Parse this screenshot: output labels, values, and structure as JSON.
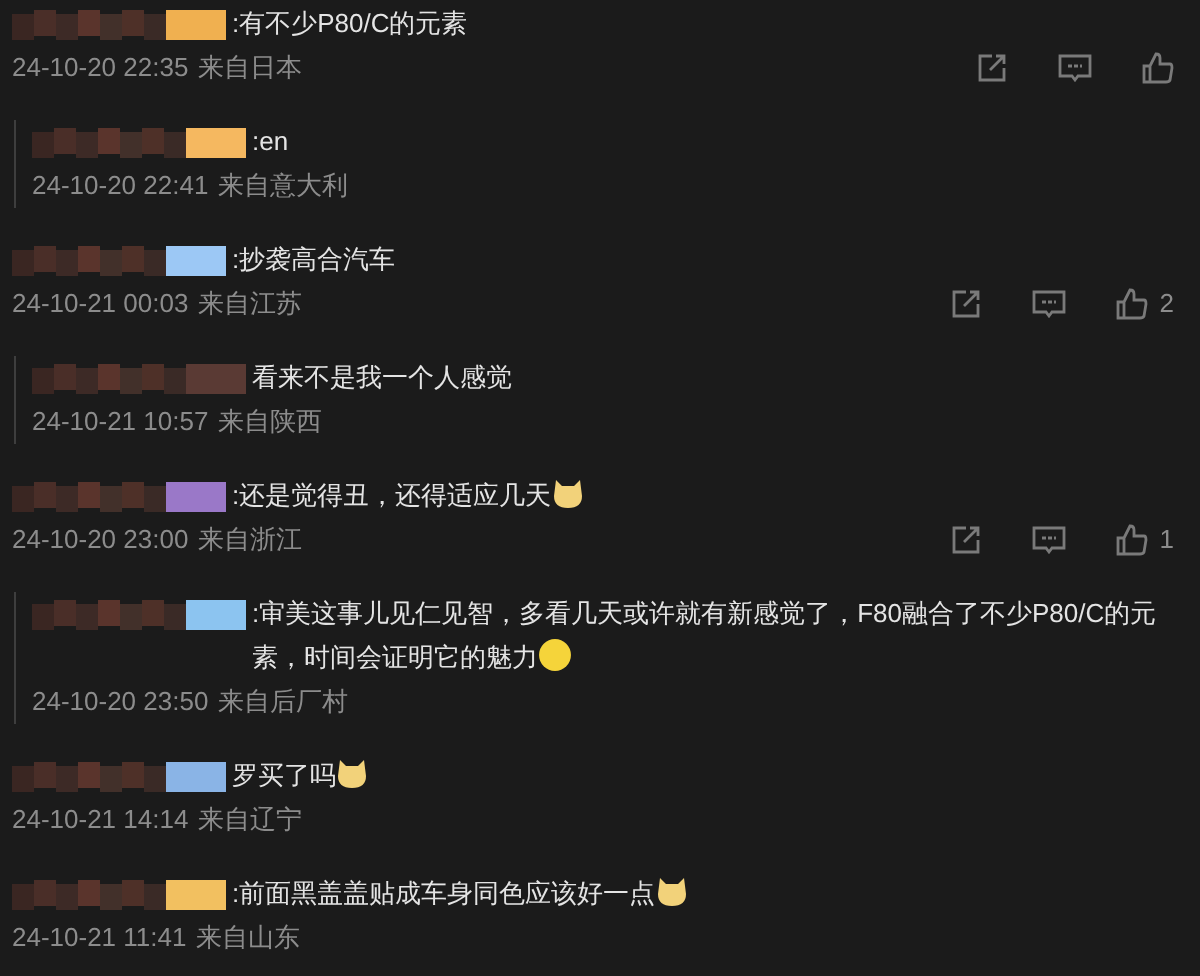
{
  "comments": [
    {
      "kind": "comment",
      "color": "#f0b050",
      "text": ":有不少P80/C的元素",
      "time": "24-10-20 22:35",
      "location": "来自日本",
      "actions": true
    },
    {
      "kind": "reply",
      "color": "#f5b860",
      "text": ":en",
      "time": "24-10-20 22:41",
      "location": "来自意大利",
      "actions": false
    },
    {
      "kind": "comment",
      "color": "#9cc8f5",
      "text": ":抄袭高合汽车",
      "time": "24-10-21 00:03",
      "location": "来自江苏",
      "actions": true,
      "likes": "2"
    },
    {
      "kind": "reply",
      "color": "#5a3a34",
      "text": "看来不是我一个人感觉",
      "time": "24-10-21 10:57",
      "location": "来自陕西",
      "actions": false
    },
    {
      "kind": "comment",
      "color": "#9a78c8",
      "text": ":还是觉得丑，还得适应几天",
      "emoji": {
        "kind": "doge"
      },
      "time": "24-10-20 23:00",
      "location": "来自浙江",
      "actions": true,
      "likes": "1"
    },
    {
      "kind": "reply",
      "color": "#8cc4f0",
      "text": ":审美这事儿见仁见智，多看几天或许就有新感觉了，F80融合了不少P80/C的元素，时间会证明它的魅力",
      "emoji": {
        "kind": "smile"
      },
      "time": "24-10-20 23:50",
      "location": "来自后厂村",
      "actions": false
    },
    {
      "kind": "comment",
      "color": "#8ab4e6",
      "text": "罗买了吗",
      "emoji": {
        "kind": "doge"
      },
      "time": "24-10-21 14:14",
      "location": "来自辽宁",
      "actions": false
    },
    {
      "kind": "comment",
      "color": "#f2c060",
      "text": ":前面黑盖盖贴成车身同色应该好一点",
      "emoji": {
        "kind": "doge"
      },
      "time": "24-10-21 11:41",
      "location": "来自山东",
      "actions": false
    }
  ]
}
